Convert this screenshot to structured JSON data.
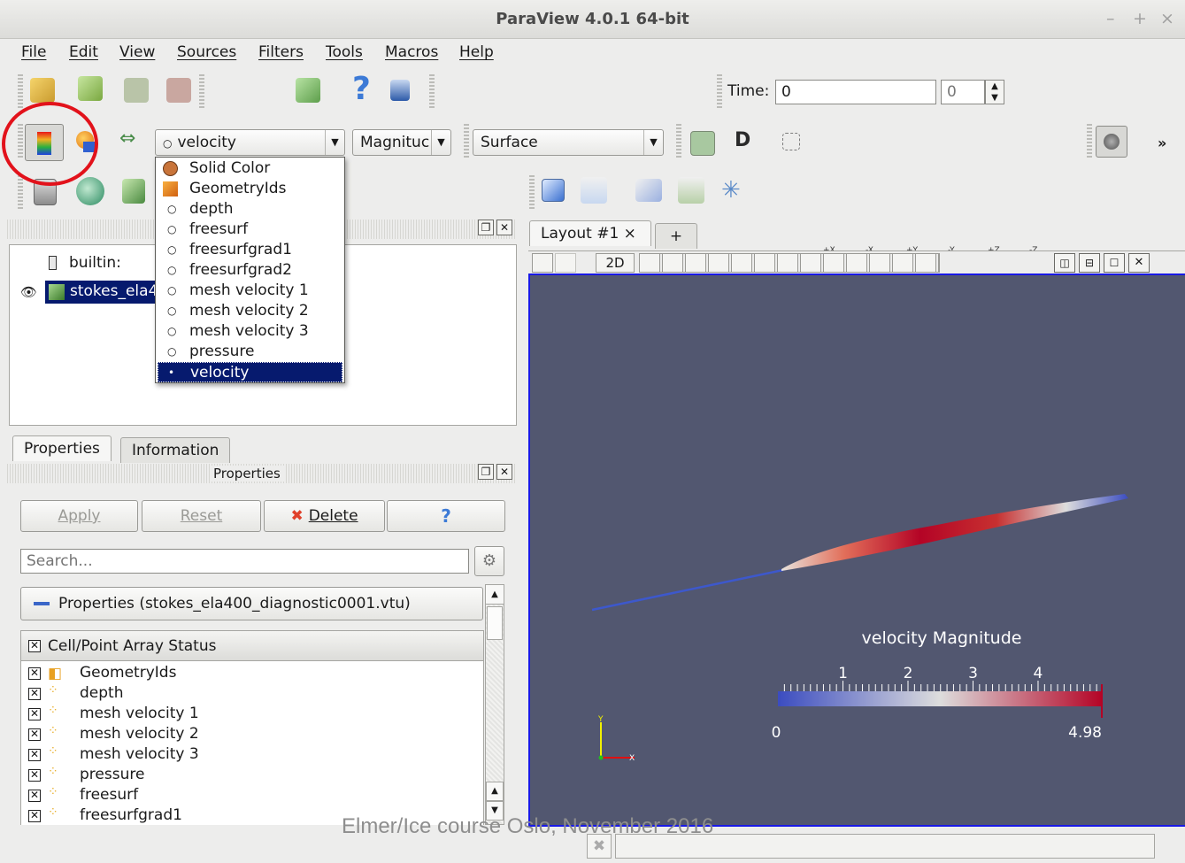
{
  "window": {
    "title": "ParaView 4.0.1 64-bit",
    "controls": [
      "–",
      "+",
      "×"
    ]
  },
  "menubar": [
    "File",
    "Edit",
    "View",
    "Sources",
    "Filters",
    "Tools",
    "Macros",
    "Help"
  ],
  "time_toolbar": {
    "label": "Time:",
    "value": "0",
    "step_value": "0"
  },
  "display_toolbar": {
    "color_by": "velocity",
    "component": "Magnituc",
    "representation": "Surface",
    "more_label": "»"
  },
  "color_dropdown": {
    "items": [
      {
        "label": "Solid Color",
        "icon": "solid-color-icon"
      },
      {
        "label": "GeometryIds",
        "icon": "cell-data-icon"
      },
      {
        "label": "depth",
        "icon": "point-data-icon"
      },
      {
        "label": "freesurf",
        "icon": "point-data-icon"
      },
      {
        "label": "freesurfgrad1",
        "icon": "point-data-icon"
      },
      {
        "label": "freesurfgrad2",
        "icon": "point-data-icon"
      },
      {
        "label": "mesh velocity 1",
        "icon": "point-data-icon"
      },
      {
        "label": "mesh velocity 2",
        "icon": "point-data-icon"
      },
      {
        "label": "mesh velocity 3",
        "icon": "point-data-icon"
      },
      {
        "label": "pressure",
        "icon": "point-data-icon"
      },
      {
        "label": "velocity",
        "icon": "point-data-icon",
        "selected": true
      }
    ]
  },
  "pipeline": {
    "root": "builtin:",
    "source": "stokes_ela4"
  },
  "tabs": {
    "properties": "Properties",
    "information": "Information"
  },
  "properties_panel": {
    "header": "Properties",
    "apply": "Apply",
    "reset": "Reset",
    "delete": "Delete",
    "help": "?",
    "search_placeholder": "Search...",
    "group_title": "Properties (stokes_ela400_diagnostic0001.vtu)",
    "array_header": "Cell/Point Array Status",
    "arrays": [
      "GeometryIds",
      "depth",
      "mesh velocity 1",
      "mesh velocity 2",
      "mesh velocity 3",
      "pressure",
      "freesurf",
      "freesurfgrad1"
    ]
  },
  "layout": {
    "tab": "Layout #1",
    "close": "×",
    "add": "+",
    "view_mode": "2D"
  },
  "colorbar": {
    "title": "velocity Magnitude",
    "ticks": [
      "1",
      "2",
      "3",
      "4"
    ],
    "min": "0",
    "max": "4.98",
    "range": [
      0,
      4.98
    ],
    "colors": {
      "low": "#3b4cc0",
      "mid": "#dddddd",
      "high": "#b40426"
    }
  },
  "footer": {
    "overlay_text": "Elmer/Ice course Oslo, November 2016"
  }
}
